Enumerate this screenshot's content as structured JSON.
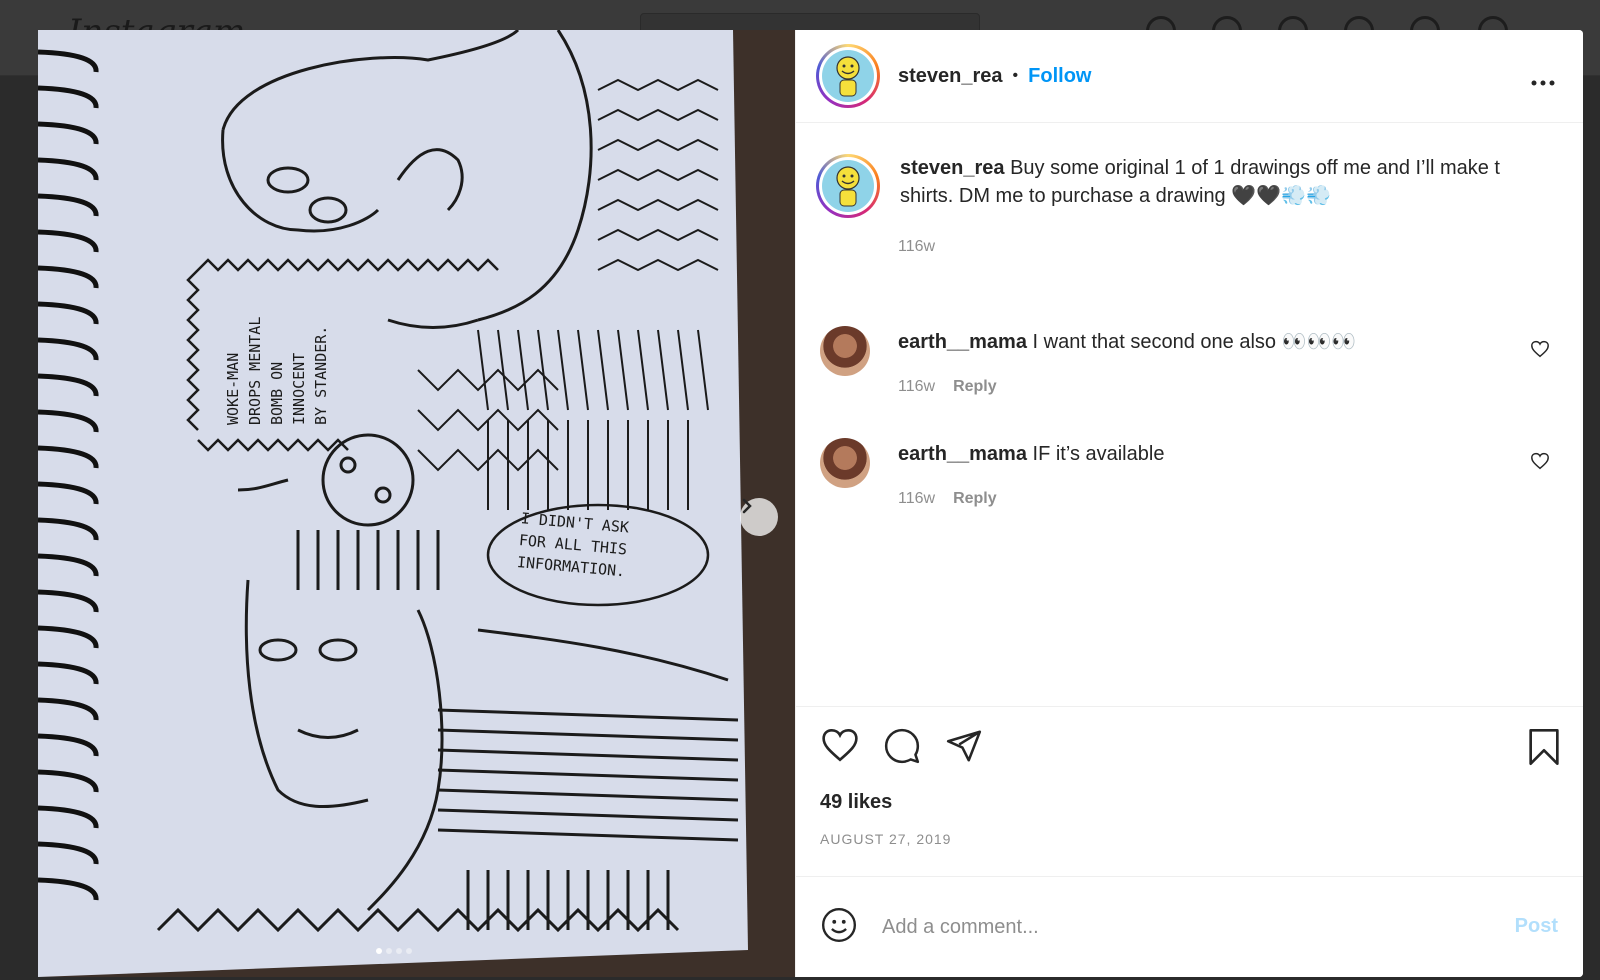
{
  "background": {
    "logo_text": "Instagram"
  },
  "post": {
    "author": "steven_rea",
    "follow_label": "Follow",
    "separator": "•",
    "more_icon": "more-horizontal-icon",
    "caption": {
      "username": "steven_rea",
      "text": " Buy some original 1 of 1 drawings off me and I’ll make t shirts. DM me to purchase a drawing 🖤🖤💨💨",
      "time": "116w"
    },
    "comments": [
      {
        "username": "earth__mama",
        "text": " I want that second one also 👀👀👀",
        "time": "116w",
        "reply_label": "Reply"
      },
      {
        "username": "earth__mama",
        "text": " IF it’s available",
        "time": "116w",
        "reply_label": "Reply"
      }
    ],
    "likes": "49 likes",
    "date": "AUGUST 27, 2019",
    "add_comment_placeholder": "Add a comment...",
    "post_label": "Post"
  },
  "media": {
    "drawing_text_1": "WOKE-MAN DROPS MENTAL BOMB ON INNOCENT BY STANDER.",
    "drawing_text_2": "I DIDN'T ASK FOR ALL THIS INFORMATION.",
    "carousel_dots": 4,
    "active_dot": 0
  },
  "colors": {
    "accent": "#0095f6",
    "post_disabled": "#b2dffc",
    "muted": "#8e8e8e",
    "border": "#efefef"
  }
}
